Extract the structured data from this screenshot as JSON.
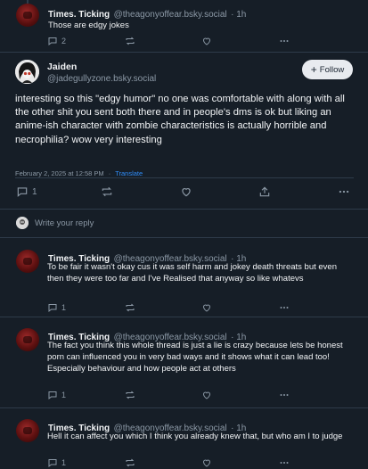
{
  "top_reply": {
    "author": "Times. Ticking",
    "handle": "@theagonyoffear.bsky.social",
    "time": "· 1h",
    "text": "Those are edgy jokes",
    "reply_count": "2"
  },
  "main_post": {
    "author": "Jaiden",
    "handle": "@jadegullyzone.bsky.social",
    "follow_label": "Follow",
    "text": "interesting so this \"edgy humor\" no one was comfortable with along with all the other shit you sent both there and in people's dms is ok but liking an anime-ish character with zombie characteristics is actually horrible and necrophilia? wow very interesting",
    "date": "February 2, 2025 at 12:58 PM",
    "dot": "·",
    "translate_label": "Translate",
    "reply_count": "1"
  },
  "composer": {
    "placeholder": "Write your reply"
  },
  "replies": [
    {
      "author": "Times. Ticking",
      "handle": "@theagonyoffear.bsky.social",
      "time": "· 1h",
      "text": "To be fair it wasn't okay cus it was self harm and jokey death threats but even then they were too far and I've Realised that anyway so like whatevs",
      "reply_count": "1"
    },
    {
      "author": "Times. Ticking",
      "handle": "@theagonyoffear.bsky.social",
      "time": "· 1h",
      "text": "The fact you think this whole thread is just a lie is crazy because lets be honest porn can influenced you in very bad ways and it shows what it can lead too!\nEspecially behaviour and how people act at others",
      "reply_count": "1"
    },
    {
      "author": "Times. Ticking",
      "handle": "@theagonyoffear.bsky.social",
      "time": "· 1h",
      "text": "Hell it can affect you which I think you already knew that, but who am I to judge",
      "reply_count": "1"
    }
  ],
  "colors": {
    "background": "#161e27",
    "muted": "#8b98a5",
    "accent": "#2f8cf7",
    "separator": "#2e3b4a"
  }
}
